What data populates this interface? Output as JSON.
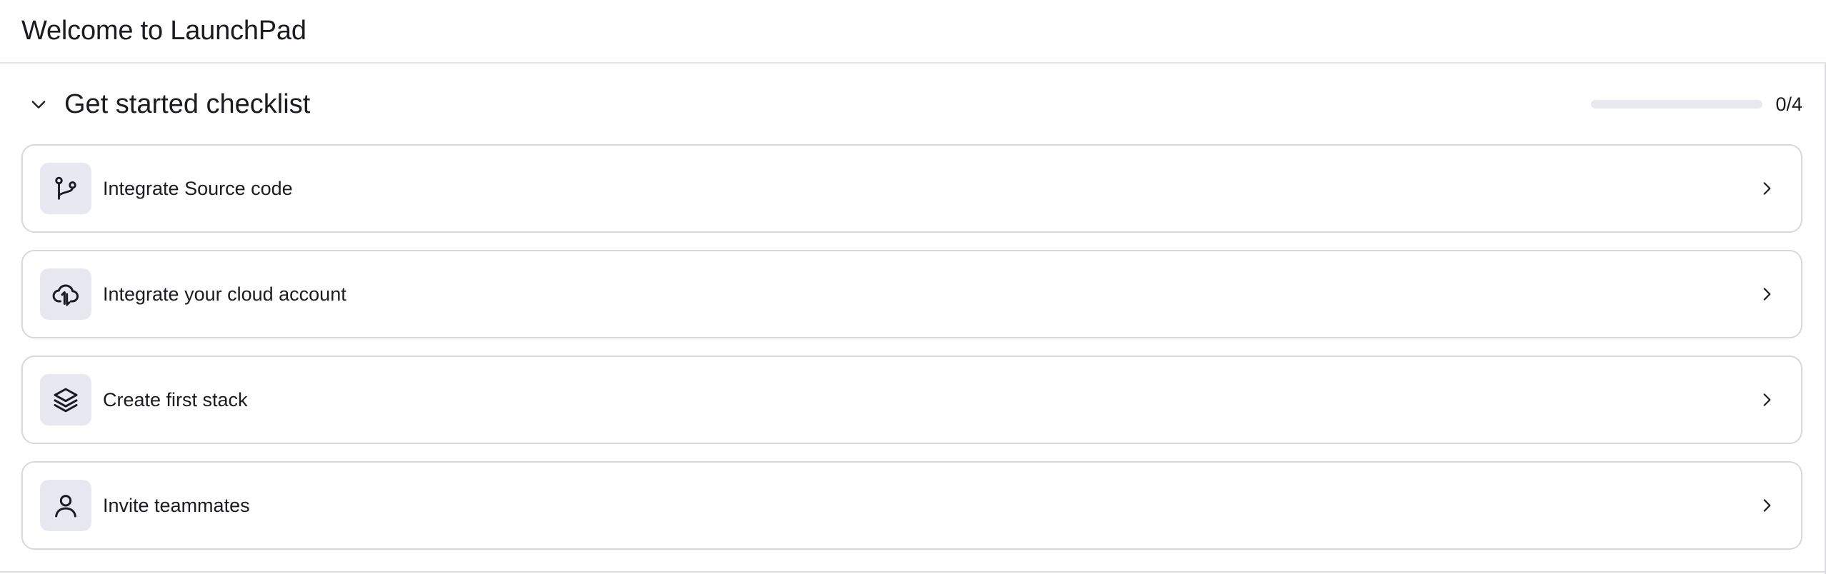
{
  "page": {
    "title": "Welcome to LaunchPad"
  },
  "checklist": {
    "title": "Get started checklist",
    "expanded": true,
    "toggle_icon": "chevron-down-icon",
    "progress": {
      "completed": 0,
      "total": 4,
      "fraction": 0,
      "label": "0/4"
    },
    "items": [
      {
        "label": "Integrate Source code",
        "icon": "git-branch-icon"
      },
      {
        "label": "Integrate your cloud account",
        "icon": "cloud-upload-icon"
      },
      {
        "label": "Create first stack",
        "icon": "layers-icon"
      },
      {
        "label": "Invite teammates",
        "icon": "user-icon"
      }
    ]
  },
  "colors": {
    "text": "#1b1b22",
    "border": "#d7d7de",
    "icon_tile_bg": "#e8e8f1",
    "progress_track": "#e8e8f0"
  }
}
